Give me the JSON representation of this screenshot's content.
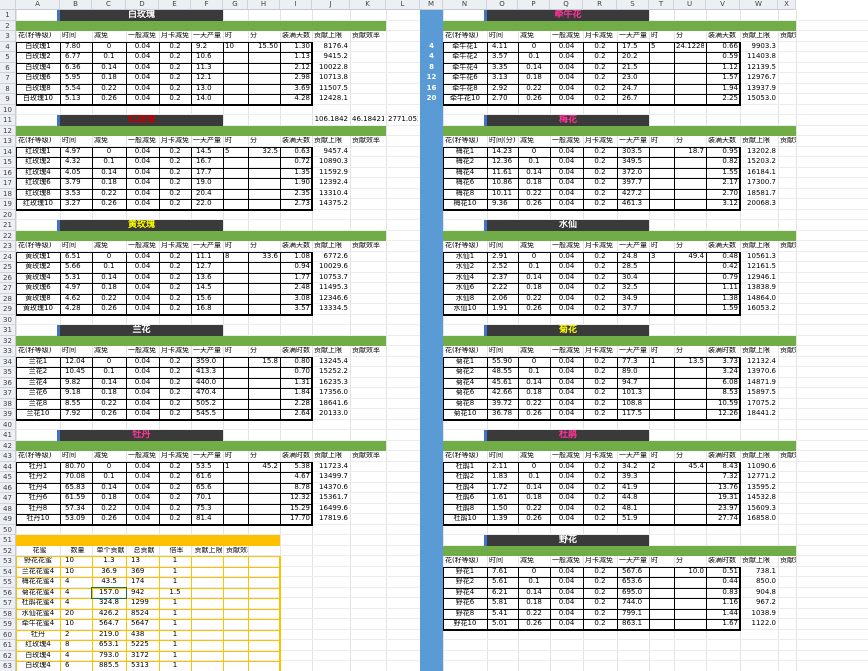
{
  "columns": [
    "A",
    "B",
    "C",
    "D",
    "E",
    "F",
    "G",
    "H",
    "I",
    "J",
    "K",
    "L",
    "M",
    "N",
    "O",
    "P",
    "Q",
    "R",
    "S",
    "T",
    "U",
    "V",
    "W",
    "X"
  ],
  "rows": [
    "1",
    "2",
    "3",
    "4",
    "5",
    "6",
    "7",
    "8",
    "9",
    "10",
    "11",
    "12",
    "13",
    "14",
    "15",
    "16",
    "17",
    "18",
    "19",
    "20",
    "21",
    "22",
    "23",
    "24",
    "25",
    "26",
    "27",
    "28",
    "29",
    "30",
    "31",
    "32",
    "33",
    "34",
    "35",
    "36",
    "37",
    "38",
    "39",
    "40",
    "41",
    "42",
    "43",
    "44",
    "45",
    "46",
    "47",
    "48",
    "49",
    "50",
    "51",
    "52",
    "53",
    "54",
    "55",
    "56",
    "57",
    "58",
    "59",
    "60",
    "61",
    "62",
    "63"
  ],
  "colors": {
    "title_bg": "#3a3a3a",
    "green_band": "#70ad47",
    "blue_band": "#5b9bd5",
    "orange": "#ffc000",
    "white_title": "#ffffff",
    "yellow_title": "#ffff00",
    "pink_title": "#ff3399",
    "red_title": "#c00000"
  },
  "headers_std": [
    "花(籽等级)",
    "时间",
    "减免",
    "一般减免",
    "月卡减免",
    "一天产量",
    "时",
    "分",
    "装满天数",
    "贡献上限",
    "贡献效率"
  ],
  "headers_time": [
    "花(籽等级)",
    "时间",
    "减免",
    "一般减免",
    "月卡减免",
    "一天产量",
    "时",
    "分",
    "装满时数",
    "贡献上限",
    "贡献效率"
  ],
  "headers_plum": [
    "花(籽等级)",
    "时间(分)",
    "减免",
    "一般减免",
    "月卡减免",
    "一天产量",
    "时",
    "分",
    "装满天数",
    "贡献上限",
    "贡献效率"
  ],
  "blocks_left": [
    {
      "title": "白玫瑰",
      "title_color": "white",
      "h": "std",
      "time": {
        "row": 1,
        "h": "10",
        "m": "15.50"
      },
      "rows": [
        [
          "白玫瑰1",
          "7.80",
          "0",
          "0.04",
          "0.2",
          "9.2",
          "1.30",
          "8176.4"
        ],
        [
          "白玫瑰2",
          "6.77",
          "0.1",
          "0.04",
          "0.2",
          "10.6",
          "1.13",
          "9415.2"
        ],
        [
          "白玫瑰4",
          "6.36",
          "0.14",
          "0.04",
          "0.2",
          "11.3",
          "2.12",
          "10022.8"
        ],
        [
          "白玫瑰6",
          "5.95",
          "0.18",
          "0.04",
          "0.2",
          "12.1",
          "2.98",
          "10713.8"
        ],
        [
          "白玫瑰8",
          "5.54",
          "0.22",
          "0.04",
          "0.2",
          "13.0",
          "3.69",
          "11507.5"
        ],
        [
          "白玫瑰10",
          "5.13",
          "0.26",
          "0.04",
          "0.2",
          "14.0",
          "4.28",
          "12428.1"
        ]
      ],
      "extra": [
        "106.1842",
        "46.18421",
        "2771.053"
      ]
    },
    {
      "title": "红玫瑰",
      "title_color": "red",
      "h": "std",
      "time": {
        "row": 1,
        "h": "5",
        "m": "32.5"
      },
      "rows": [
        [
          "红玫瑰1",
          "4.97",
          "0",
          "0.04",
          "0.2",
          "14.5",
          "0.63",
          "9457.4"
        ],
        [
          "红玫瑰2",
          "4.32",
          "0.1",
          "0.04",
          "0.2",
          "16.7",
          "0.72",
          "10890.3"
        ],
        [
          "红玫瑰4",
          "4.05",
          "0.14",
          "0.04",
          "0.2",
          "17.7",
          "1.35",
          "11592.9"
        ],
        [
          "红玫瑰6",
          "3.79",
          "0.18",
          "0.04",
          "0.2",
          "19.0",
          "1.90",
          "12392.4"
        ],
        [
          "红玫瑰8",
          "3.53",
          "0.22",
          "0.04",
          "0.2",
          "20.4",
          "2.35",
          "13310.4"
        ],
        [
          "红玫瑰10",
          "3.27",
          "0.26",
          "0.04",
          "0.2",
          "22.0",
          "2.73",
          "14375.2"
        ]
      ]
    },
    {
      "title": "黄玫瑰",
      "title_color": "yellow",
      "h": "std",
      "time": {
        "row": 1,
        "h": "8",
        "m": "33.6"
      },
      "rows": [
        [
          "黄玫瑰1",
          "6.51",
          "0",
          "0.04",
          "0.2",
          "11.1",
          "1.08",
          "6772.6"
        ],
        [
          "黄玫瑰2",
          "5.66",
          "0.1",
          "0.04",
          "0.2",
          "12.7",
          "0.94",
          "10029.6"
        ],
        [
          "黄玫瑰4",
          "5.31",
          "0.14",
          "0.04",
          "0.2",
          "13.6",
          "1.77",
          "10753.7"
        ],
        [
          "黄玫瑰6",
          "4.97",
          "0.18",
          "0.04",
          "0.2",
          "14.5",
          "2.48",
          "11495.3"
        ],
        [
          "黄玫瑰8",
          "4.62",
          "0.22",
          "0.04",
          "0.2",
          "15.6",
          "3.08",
          "12346.6"
        ],
        [
          "黄玫瑰10",
          "4.28",
          "0.26",
          "0.04",
          "0.2",
          "16.8",
          "3.57",
          "13334.5"
        ]
      ]
    },
    {
      "title": "兰花",
      "title_color": "white",
      "h": "time",
      "time": {
        "row": 1,
        "h": "",
        "m": "15.8"
      },
      "rows": [
        [
          "兰花1",
          "12.04",
          "0",
          "0.04",
          "0.2",
          "359.0",
          "0.80",
          "13245.4"
        ],
        [
          "兰花2",
          "10.45",
          "0.1",
          "0.04",
          "0.2",
          "413.3",
          "0.70",
          "15252.2"
        ],
        [
          "兰花4",
          "9.82",
          "0.14",
          "0.04",
          "0.2",
          "440.0",
          "1.31",
          "16235.3"
        ],
        [
          "兰花6",
          "9.18",
          "0.18",
          "0.04",
          "0.2",
          "470.4",
          "1.84",
          "17356.0"
        ],
        [
          "兰花8",
          "8.55",
          "0.22",
          "0.04",
          "0.2",
          "505.2",
          "2.28",
          "18641.6"
        ],
        [
          "兰花10",
          "7.92",
          "0.26",
          "0.04",
          "0.2",
          "545.5",
          "2.64",
          "20133.0"
        ]
      ]
    },
    {
      "title": "牡丹",
      "title_color": "pink",
      "h": "time",
      "time": {
        "row": 1,
        "h": "1",
        "m": "45.2"
      },
      "rows": [
        [
          "牡丹1",
          "80.70",
          "0",
          "0.04",
          "0.2",
          "53.5",
          "5.38",
          "11723.4"
        ],
        [
          "牡丹2",
          "70.08",
          "0.1",
          "0.04",
          "0.2",
          "61.6",
          "4.67",
          "13499.7"
        ],
        [
          "牡丹4",
          "65.83",
          "0.14",
          "0.04",
          "0.2",
          "65.6",
          "8.78",
          "14370.6"
        ],
        [
          "牡丹6",
          "61.59",
          "0.18",
          "0.04",
          "0.2",
          "70.1",
          "12.32",
          "15361.7"
        ],
        [
          "牡丹8",
          "57.34",
          "0.22",
          "0.04",
          "0.2",
          "75.3",
          "15.29",
          "16499.6"
        ],
        [
          "牡丹10",
          "53.09",
          "0.26",
          "0.04",
          "0.2",
          "81.4",
          "17.70",
          "17819.6"
        ]
      ]
    }
  ],
  "blocks_right": [
    {
      "title": "牵牛花",
      "title_color": "pink",
      "h": "std",
      "time": {
        "row": 1,
        "h": "5",
        "m": "24.12281"
      },
      "rows": [
        [
          "牵牛花1",
          "4.11",
          "0",
          "0.04",
          "0.2",
          "17.5",
          "0.66",
          "9903.3"
        ],
        [
          "牵牛花2",
          "3.57",
          "0.1",
          "0.04",
          "0.2",
          "20.2",
          "0.59",
          "11403.8"
        ],
        [
          "牵牛花4",
          "3.35",
          "0.14",
          "0.04",
          "0.2",
          "21.5",
          "1.12",
          "12139.5"
        ],
        [
          "牵牛花6",
          "3.13",
          "0.18",
          "0.04",
          "0.2",
          "23.0",
          "1.57",
          "12976.7"
        ],
        [
          "牵牛花8",
          "2.92",
          "0.22",
          "0.04",
          "0.2",
          "24.7",
          "1.94",
          "13937.9"
        ],
        [
          "牵牛花10",
          "2.70",
          "0.26",
          "0.04",
          "0.2",
          "26.7",
          "2.25",
          "15053.0"
        ]
      ]
    },
    {
      "title": "梅花",
      "title_color": "pink",
      "h": "plum",
      "time": {
        "row": 1,
        "h": "",
        "m": "18.7"
      },
      "rows": [
        [
          "梅花1",
          "14.23",
          "0",
          "0.04",
          "0.2",
          "303.5",
          "0.95",
          "13202.8"
        ],
        [
          "梅花2",
          "12.36",
          "0.1",
          "0.04",
          "0.2",
          "349.5",
          "0.82",
          "15203.2"
        ],
        [
          "梅花4",
          "11.61",
          "0.14",
          "0.04",
          "0.2",
          "372.0",
          "1.55",
          "16184.1"
        ],
        [
          "梅花6",
          "10.86",
          "0.18",
          "0.04",
          "0.2",
          "397.7",
          "2.17",
          "17300.7"
        ],
        [
          "梅花8",
          "10.11",
          "0.22",
          "0.04",
          "0.2",
          "427.2",
          "2.70",
          "18581.7"
        ],
        [
          "梅花10",
          "9.36",
          "0.26",
          "0.04",
          "0.2",
          "461.3",
          "3.12",
          "20068.3"
        ]
      ]
    },
    {
      "title": "水仙",
      "title_color": "white",
      "h": "std",
      "time": {
        "row": 1,
        "h": "3",
        "m": "49.4"
      },
      "rows": [
        [
          "水仙1",
          "2.91",
          "0",
          "0.04",
          "0.2",
          "24.8",
          "0.48",
          "10561.3"
        ],
        [
          "水仙2",
          "2.52",
          "0.1",
          "0.04",
          "0.2",
          "28.5",
          "0.42",
          "12161.5"
        ],
        [
          "水仙4",
          "2.37",
          "0.14",
          "0.04",
          "0.2",
          "30.4",
          "0.79",
          "12946.1"
        ],
        [
          "水仙6",
          "2.22",
          "0.18",
          "0.04",
          "0.2",
          "32.5",
          "1.11",
          "13838.9"
        ],
        [
          "水仙8",
          "2.06",
          "0.22",
          "0.04",
          "0.2",
          "34.9",
          "1.38",
          "14864.0"
        ],
        [
          "水仙10",
          "1.91",
          "0.26",
          "0.04",
          "0.2",
          "37.7",
          "1.59",
          "16053.2"
        ]
      ]
    },
    {
      "title": "菊花",
      "title_color": "yellow",
      "h": "time",
      "time": {
        "row": 1,
        "h": "1",
        "m": "13.5"
      },
      "rows": [
        [
          "菊花1",
          "55.90",
          "0",
          "0.04",
          "0.2",
          "77.3",
          "3.73",
          "12132.4"
        ],
        [
          "菊花2",
          "48.55",
          "0.1",
          "0.04",
          "0.2",
          "89.0",
          "3.24",
          "13970.6"
        ],
        [
          "菊花4",
          "45.61",
          "0.14",
          "0.04",
          "0.2",
          "94.7",
          "6.08",
          "14871.9"
        ],
        [
          "菊花6",
          "42.66",
          "0.18",
          "0.04",
          "0.2",
          "101.3",
          "8.53",
          "15897.5"
        ],
        [
          "菊花8",
          "39.72",
          "0.22",
          "0.04",
          "0.2",
          "108.8",
          "10.59",
          "17075.2"
        ],
        [
          "菊花10",
          "36.78",
          "0.26",
          "0.04",
          "0.2",
          "117.5",
          "12.26",
          "18441.2"
        ]
      ]
    },
    {
      "title": "杜鹃",
      "title_color": "pink",
      "h": "time",
      "time": {
        "row": 1,
        "h": "2",
        "m": "45.4"
      },
      "rows": [
        [
          "杜鹃1",
          "2.11",
          "0",
          "0.04",
          "0.2",
          "34.2",
          "8.43",
          "11090.6"
        ],
        [
          "杜鹃2",
          "1.83",
          "0.1",
          "0.04",
          "0.2",
          "39.3",
          "7.32",
          "12771.2"
        ],
        [
          "杜鹃4",
          "1.72",
          "0.14",
          "0.04",
          "0.2",
          "41.9",
          "13.76",
          "13595.2"
        ],
        [
          "杜鹃6",
          "1.61",
          "0.18",
          "0.04",
          "0.2",
          "44.8",
          "19.31",
          "14532.8"
        ],
        [
          "杜鹃8",
          "1.50",
          "0.22",
          "0.04",
          "0.2",
          "48.1",
          "23.97",
          "15609.3"
        ],
        [
          "杜鹃10",
          "1.39",
          "0.26",
          "0.04",
          "0.2",
          "51.9",
          "27.74",
          "16858.0"
        ]
      ]
    },
    {
      "title": "野花",
      "title_color": "white",
      "h": "time",
      "time": {
        "row": 1,
        "h": "",
        "m": "10.0"
      },
      "rows": [
        [
          "野花1",
          "7.61",
          "0",
          "0.04",
          "0.2",
          "567.6",
          "0.51",
          "738.1"
        ],
        [
          "野花2",
          "5.61",
          "0.1",
          "0.04",
          "0.2",
          "653.6",
          "0.44",
          "850.0"
        ],
        [
          "野花4",
          "6.21",
          "0.14",
          "0.04",
          "0.2",
          "695.0",
          "0.83",
          "904.8"
        ],
        [
          "野花6",
          "5.81",
          "0.18",
          "0.04",
          "0.2",
          "744.0",
          "1.16",
          "967.2"
        ],
        [
          "野花8",
          "5.41",
          "0.22",
          "0.04",
          "0.2",
          "799.1",
          "1.44",
          "1038.9"
        ],
        [
          "野花10",
          "5.01",
          "0.26",
          "0.04",
          "0.2",
          "863.1",
          "1.67",
          "1122.0"
        ]
      ]
    }
  ],
  "blue_values": [
    "4",
    "4",
    "8",
    "12",
    "16",
    "20"
  ],
  "honey": {
    "headers": [
      "花蜜",
      "数量",
      "单个贡献",
      "总贡献",
      "倍率",
      "贡献上限",
      "贡献效率"
    ],
    "rows": [
      [
        "野花花蜜",
        "10",
        "1.3",
        "13",
        "1"
      ],
      [
        "兰花花蜜4",
        "10",
        "36.9",
        "369",
        "1"
      ],
      [
        "梅花花蜜4",
        "4",
        "43.5",
        "174",
        "1"
      ],
      [
        "菊花花蜜4",
        "4",
        "157.0",
        "942",
        "1.5"
      ],
      [
        "杜鹃花蜜4",
        "4",
        "324.8",
        "1299",
        "1"
      ],
      [
        "水仙花蜜4",
        "20",
        "426.2",
        "8524",
        "1"
      ],
      [
        "牵牛花蜜4",
        "10",
        "564.7",
        "5647",
        "1"
      ],
      [
        "牡丹",
        "2",
        "219.0",
        "438",
        "1"
      ],
      [
        "红玫瑰4",
        "8",
        "653.1",
        "5225",
        "1"
      ],
      [
        "白玫瑰4",
        "4",
        "793.0",
        "3172",
        "1"
      ],
      [
        "白玫瑰4",
        "6",
        "885.5",
        "5313",
        "1"
      ]
    ]
  }
}
